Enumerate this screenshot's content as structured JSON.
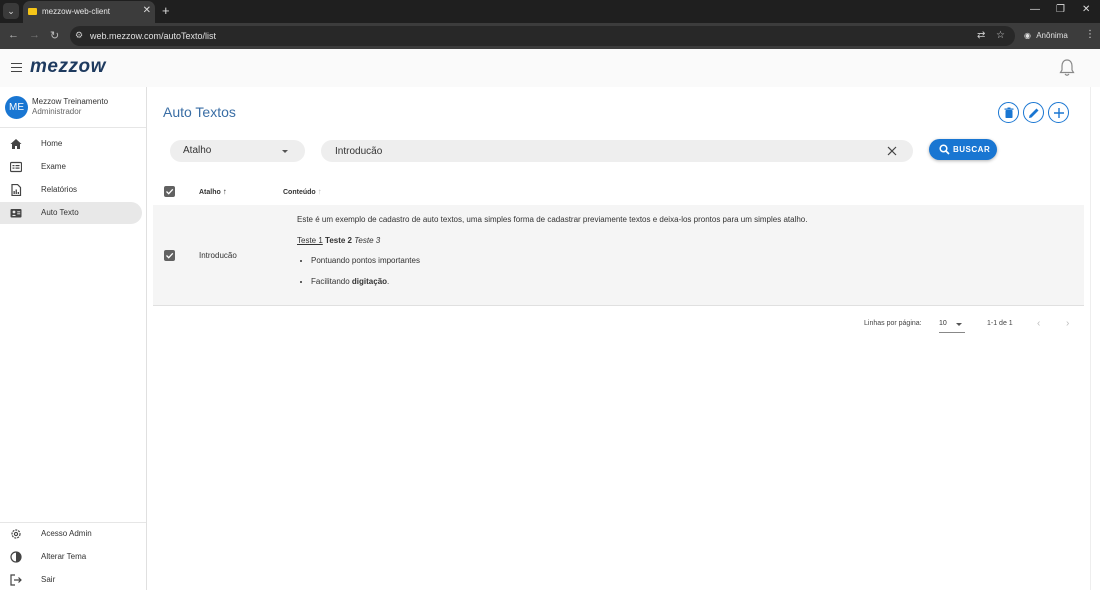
{
  "browser": {
    "tab_title": "mezzow-web-client",
    "tab_close": "✕",
    "new_tab": "+",
    "url": "web.mezzow.com/autoTexto/list",
    "incognito_label": "Anônima"
  },
  "app": {
    "logo": "mezzow"
  },
  "user": {
    "initials": "ME",
    "name": "Mezzow Treinamento",
    "role": "Administrador"
  },
  "sidebar": {
    "items": [
      {
        "label": "Home"
      },
      {
        "label": "Exame"
      },
      {
        "label": "Relatórios"
      },
      {
        "label": "Auto Texto"
      }
    ],
    "bottom_items": [
      {
        "label": "Acesso Admin"
      },
      {
        "label": "Alterar Tema"
      },
      {
        "label": "Sair"
      }
    ]
  },
  "page": {
    "title": "Auto Textos"
  },
  "filters": {
    "field_select": "Atalho",
    "search_value": "Introducão",
    "search_button": "BUSCAR"
  },
  "table": {
    "columns": {
      "shortcut": "Atalho",
      "content": "Conteúdo"
    },
    "rows": [
      {
        "shortcut": "Introducão",
        "content": {
          "paragraph": "Este é um exemplo de cadastro de auto textos, uma simples forma de cadastrar previamente textos e deixa-los prontos para um simples atalho.",
          "underline": "Teste 1",
          "bold": "Teste 2",
          "italic": "Teste 3",
          "bullet1": "Pontuando pontos importantes",
          "bullet2_prefix": "Facilitando ",
          "bullet2_bold": "digitação",
          "bullet2_suffix": "."
        }
      }
    ]
  },
  "pagination": {
    "rows_per_page_label": "Linhas por página:",
    "rows_per_page": "10",
    "range": "1-1 de 1"
  },
  "colors": {
    "primary": "#1976d2",
    "title": "#3a6ea5",
    "logo": "#1e3a5f"
  }
}
